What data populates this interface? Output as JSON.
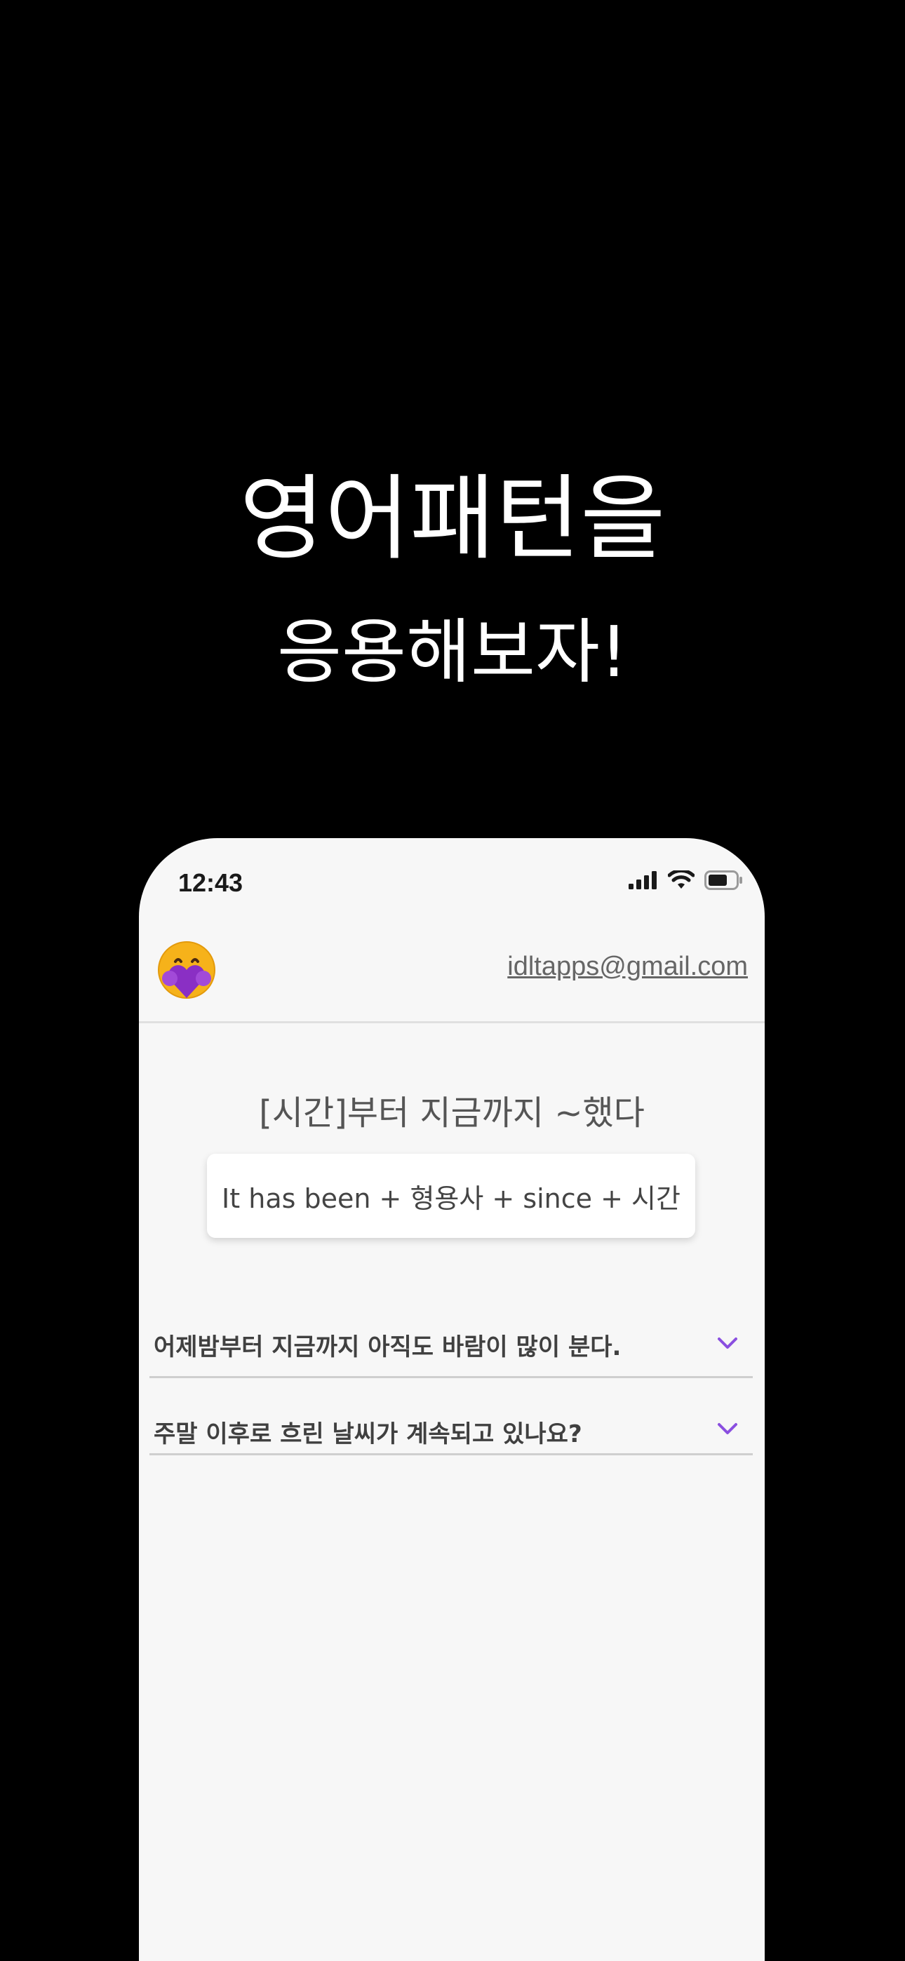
{
  "headline": {
    "line1": "영어패턴을",
    "line2": "응용해보자!"
  },
  "status_bar": {
    "time": "12:43",
    "icons": [
      "signal-icon",
      "wifi-icon",
      "battery-icon"
    ]
  },
  "header": {
    "avatar_icon": "hugging-face-emoji-icon",
    "email": "idltapps@gmail.com"
  },
  "pattern": {
    "title": "[시간]부터 지금까지 ~했다",
    "formula": "It has been + 형용사 + since + 시간"
  },
  "sentences": [
    {
      "text": "어제밤부터 지금까지 아직도 바람이 많이 분다.",
      "icon": "chevron-down-icon"
    },
    {
      "text": "주말 이후로 흐린 날씨가 계속되고 있나요?",
      "icon": "chevron-down-icon"
    }
  ],
  "colors": {
    "background": "#000000",
    "phone_background": "#f7f7f7",
    "accent": "#8a4fe0"
  }
}
